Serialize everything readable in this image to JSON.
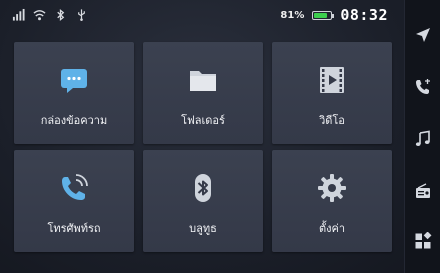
{
  "status": {
    "battery_percent_label": "81%",
    "battery_level": 0.81,
    "time": "08:32",
    "icons": [
      "signal-bars-icon",
      "wifi-icon",
      "bluetooth-icon",
      "usb-icon"
    ]
  },
  "tiles": [
    {
      "label": "กล่องข้อความ",
      "icon": "message-icon"
    },
    {
      "label": "โฟลเดอร์",
      "icon": "folder-icon"
    },
    {
      "label": "วิดีโอ",
      "icon": "video-icon"
    },
    {
      "label": "โทรศัพท์รถ",
      "icon": "car-phone-icon"
    },
    {
      "label": "บลูทูธ",
      "icon": "bluetooth-icon"
    },
    {
      "label": "ตั้งค่า",
      "icon": "gear-icon"
    }
  ],
  "sidebar": {
    "items": [
      "navigation-icon",
      "phone-icon",
      "music-icon",
      "radio-icon",
      "apps-icon"
    ]
  },
  "colors": {
    "tile_bg": "#3b4150",
    "accent_blue": "#5fb2e8",
    "icon_grey": "#d5d9e0",
    "battery_green": "#3ccf4e"
  }
}
